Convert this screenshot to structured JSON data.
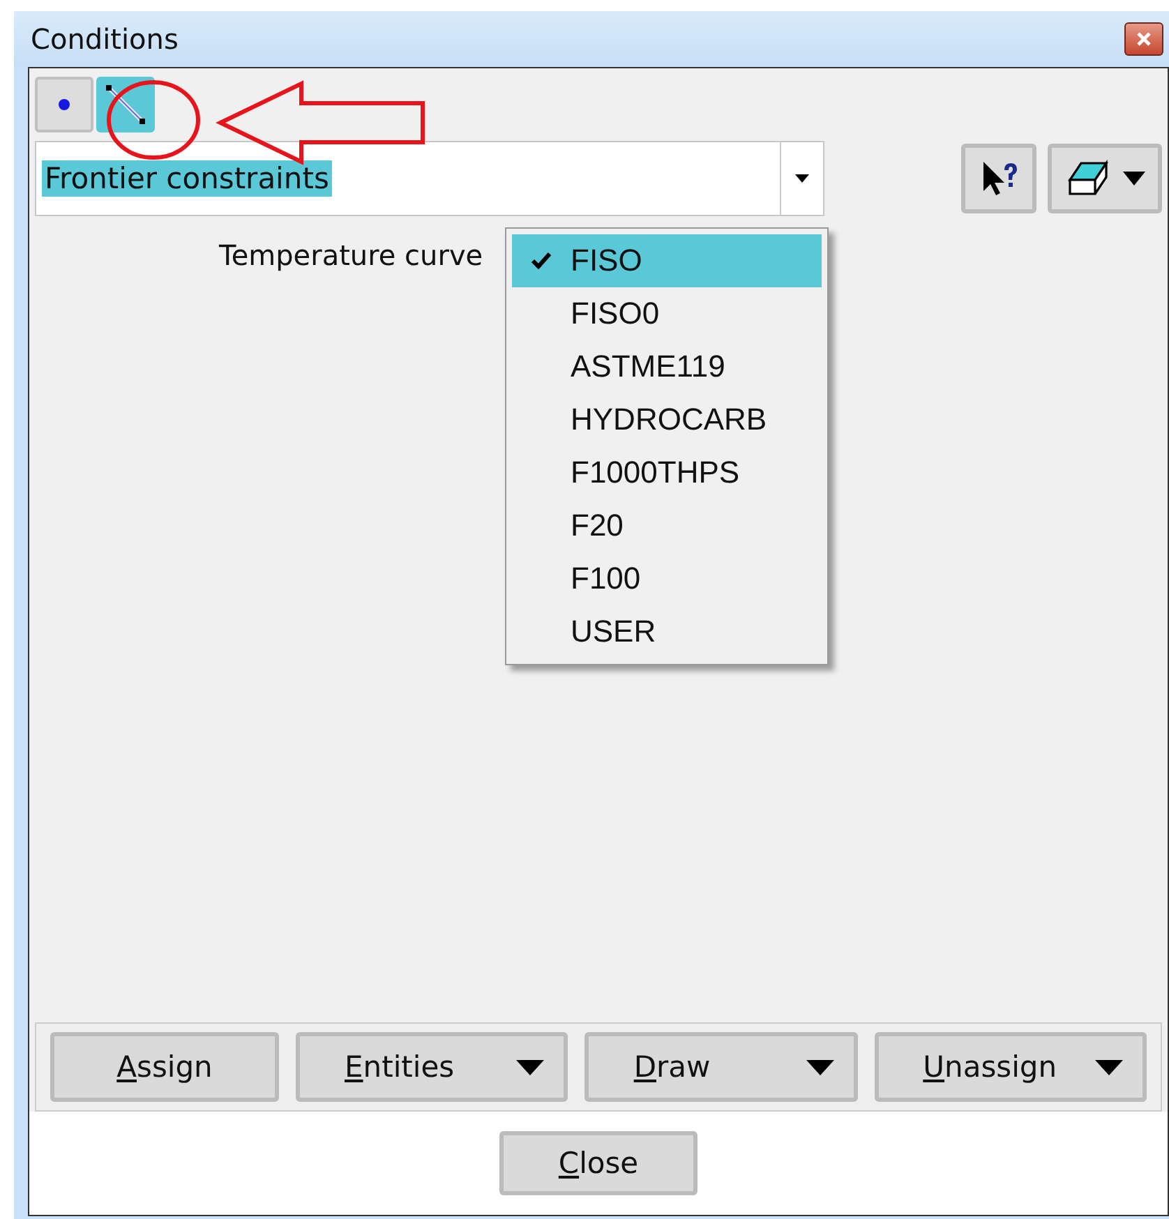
{
  "window": {
    "title": "Conditions"
  },
  "entity_tabs": [
    {
      "kind": "point",
      "selected": false
    },
    {
      "kind": "line",
      "selected": true
    }
  ],
  "book_combo": {
    "value": "Frontier constraints",
    "text_selected": true
  },
  "field": {
    "label": "Temperature curve"
  },
  "dropdown": {
    "items": [
      {
        "label": "FISO",
        "selected": true,
        "checked": true
      },
      {
        "label": "FISO0",
        "selected": false,
        "checked": false
      },
      {
        "label": "ASTME119",
        "selected": false,
        "checked": false
      },
      {
        "label": "HYDROCARB",
        "selected": false,
        "checked": false
      },
      {
        "label": "F1000THPS",
        "selected": false,
        "checked": false
      },
      {
        "label": "F20",
        "selected": false,
        "checked": false
      },
      {
        "label": "F100",
        "selected": false,
        "checked": false
      },
      {
        "label": "USER",
        "selected": false,
        "checked": false
      }
    ]
  },
  "action_buttons": [
    {
      "mnemonic": "A",
      "rest": "ssign",
      "menu": false
    },
    {
      "mnemonic": "E",
      "rest": "ntities",
      "menu": true
    },
    {
      "mnemonic": "D",
      "rest": "raw",
      "menu": true
    },
    {
      "mnemonic": "U",
      "rest": "nassign",
      "menu": true
    }
  ],
  "close_button": {
    "mnemonic": "C",
    "rest": "lose"
  }
}
